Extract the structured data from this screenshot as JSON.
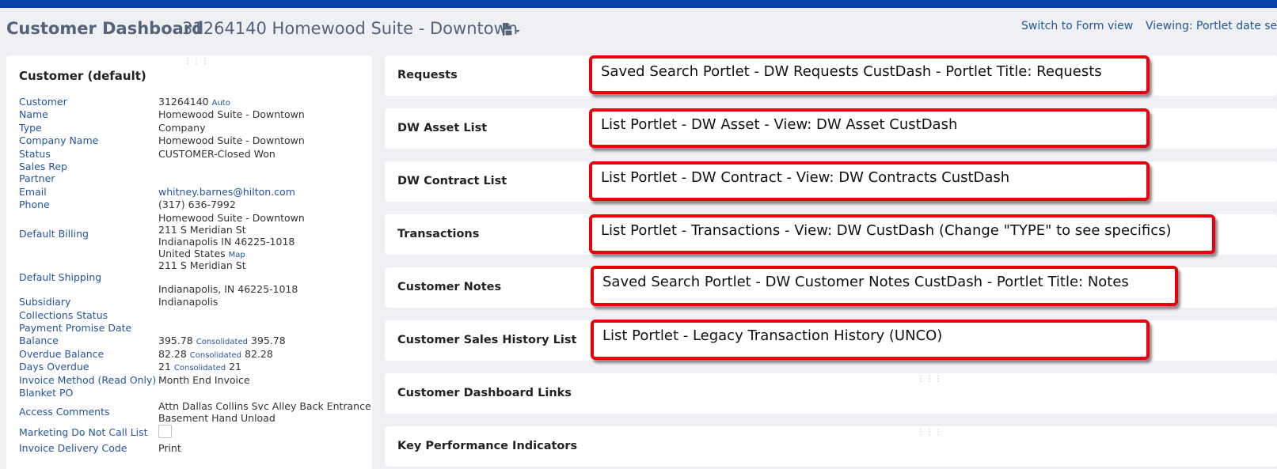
{
  "header": {
    "title": "Customer Dashboard",
    "subtitle": "31264140 Homewood Suite - Downtown",
    "switch_link": "Switch to Form view",
    "viewing_link": "Viewing: Portlet date setti"
  },
  "customer_panel": {
    "title": "Customer (default)",
    "fields": [
      {
        "label": "Customer",
        "value": "31264140",
        "extra": "Auto"
      },
      {
        "label": "Name",
        "value": "Homewood Suite - Downtown"
      },
      {
        "label": "Type",
        "value": "Company"
      },
      {
        "label": "Company Name",
        "value": "Homewood Suite - Downtown"
      },
      {
        "label": "Status",
        "value": "CUSTOMER-Closed Won"
      },
      {
        "label": "Sales Rep",
        "value": ""
      },
      {
        "label": "Partner",
        "value": ""
      },
      {
        "label": "Email",
        "value": "whitney.barnes@hilton.com"
      },
      {
        "label": "Phone",
        "value": "(317) 636-7992"
      },
      {
        "label": "Default Billing",
        "lines": [
          "Homewood Suite - Downtown",
          "211 S Meridian St",
          "Indianapolis IN 46225-1018",
          "United States"
        ],
        "extra": "Map"
      },
      {
        "label": "Default Shipping",
        "lines": [
          "211 S Meridian St",
          "",
          "Indianapolis, IN 46225-1018"
        ]
      },
      {
        "label": "Subsidiary",
        "value": "Indianapolis"
      },
      {
        "label": "Collections Status",
        "value": ""
      },
      {
        "label": "Payment Promise Date",
        "value": ""
      },
      {
        "label": "Balance",
        "value": "395.78",
        "extra": "Consolidated",
        "extra_value": "395.78"
      },
      {
        "label": "Overdue Balance",
        "value": "82.28",
        "extra": "Consolidated",
        "extra_value": "82.28"
      },
      {
        "label": "Days Overdue",
        "value": "21",
        "extra": "Consolidated",
        "extra_value": "21"
      },
      {
        "label": "Invoice Method (Read Only)",
        "value": "Month End Invoice"
      },
      {
        "label": "Blanket PO",
        "value": ""
      },
      {
        "label": "Access Comments",
        "lines": [
          "Attn Dallas Collins Svc Alley Back Entrance",
          "Basement Hand Unload"
        ]
      },
      {
        "label": "Marketing Do Not Call List",
        "checked": false
      },
      {
        "label": "Invoice Delivery Code",
        "value": "Print"
      }
    ]
  },
  "portlets": [
    {
      "title": "Requests",
      "note": "Saved Search Portlet - DW Requests CustDash - Portlet Title: Requests"
    },
    {
      "title": "DW Asset List",
      "note": "List Portlet - DW Asset - View: DW Asset CustDash"
    },
    {
      "title": "DW Contract List",
      "note": "List Portlet - DW Contract - View: DW Contracts CustDash"
    },
    {
      "title": "Transactions",
      "note": "List Portlet - Transactions - View: DW CustDash (Change \"TYPE\" to see specifics)"
    },
    {
      "title": "Customer Notes",
      "note": "Saved Search Portlet - DW Customer Notes CustDash - Portlet Title:  Notes"
    },
    {
      "title": "Customer Sales History List",
      "note": "List Portlet - Legacy Transaction History (UNCO)"
    },
    {
      "title": "Customer Dashboard Links"
    },
    {
      "title": "Key Performance Indicators"
    }
  ]
}
